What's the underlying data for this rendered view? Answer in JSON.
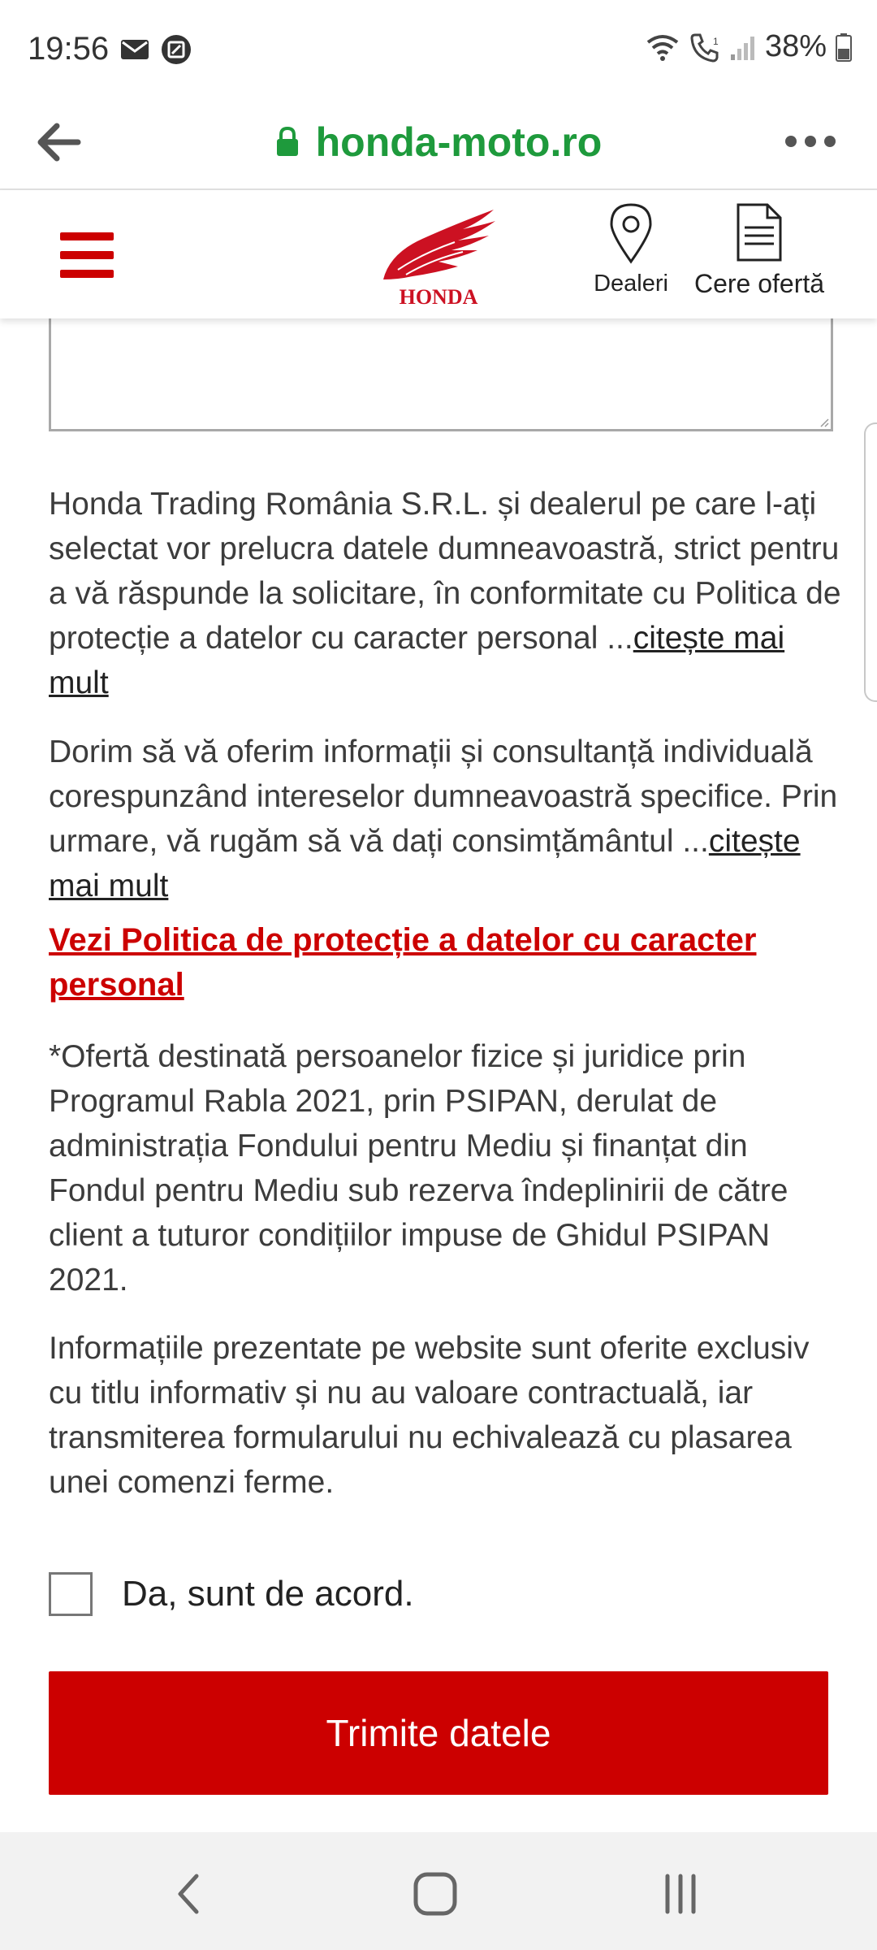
{
  "status_bar": {
    "time": "19:56",
    "icons_left": [
      "mail-icon",
      "screenshot-icon"
    ],
    "icons_right": [
      "wifi-icon",
      "call-icon",
      "signal-icon",
      "battery-icon"
    ],
    "battery": "38%"
  },
  "browser": {
    "url": "honda-moto.ro",
    "icons": [
      "back-arrow-icon",
      "lock-icon",
      "more-icon"
    ]
  },
  "header": {
    "logo_text": "HONDA",
    "dealers_label": "Dealeri",
    "offer_label": "Cere ofertă",
    "brand_color": "#cc0000"
  },
  "content": {
    "para1_text": "Honda Trading România S.R.L. și dealerul pe care l-ați selectat vor prelucra datele dumneavoastră, strict pentru a vă răspunde la solicitare, în conformitate cu Politica de protecție a datelor cu caracter personal",
    "para1_ellipsis": "...",
    "para1_link": "citește mai mult",
    "para2_text": "Dorim să vă oferim informații și consultanță individuală corespunzând intereselor dumneavoastră specifice. Prin urmare, vă rugăm să vă dați consimțământul",
    "para2_ellipsis": "...",
    "para2_link": "citește mai mult",
    "policy_link": "Vezi Politica de protecție a datelor cu caracter personal",
    "offer_note": "*Ofertă destinată persoanelor fizice și juridice prin Programul Rabla 2021, prin PSIPAN, derulat de administrația Fondului pentru Mediu și finanțat din Fondul pentru Mediu sub rezerva îndeplinirii de către client a tuturor condițiilor impuse de Ghidul PSIPAN 2021.",
    "disclaimer": "Informațiile prezentate pe website sunt oferite exclusiv cu titlu informativ și nu au valoare contractuală, iar transmiterea formularului nu echivalează cu plasarea unei comenzi ferme.",
    "consent_label": "Da, sunt de acord.",
    "consent_checked": false,
    "submit_label": "Trimite datele"
  },
  "nav_bar": {
    "buttons": [
      "back-nav-icon",
      "home-nav-icon",
      "recents-nav-icon"
    ]
  }
}
